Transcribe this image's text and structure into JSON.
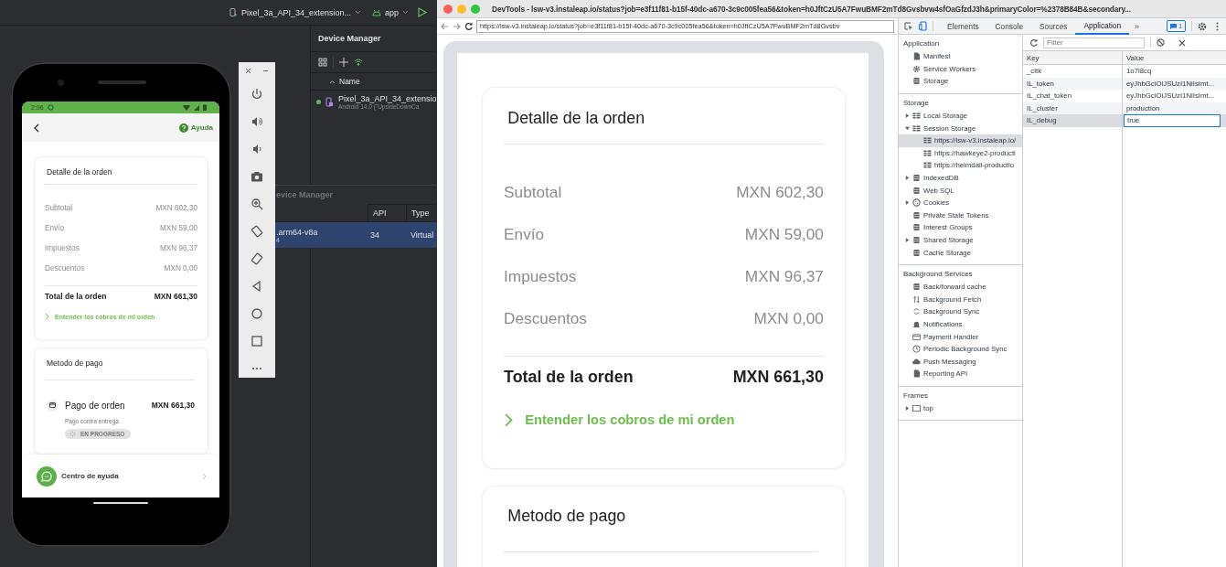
{
  "android_studio": {
    "toolbar": {
      "device": "Pixel_3a_API_34_extension...",
      "run_config": "app"
    },
    "device_manager": {
      "title": "Device Manager",
      "column": "Name",
      "devices": [
        {
          "name": "Pixel_3a_API_34_extensio",
          "details": "Android 14.0 (\"UpsideDownCa",
          "running": true
        }
      ]
    },
    "device_manager_window": {
      "title": "evice Manager",
      "columns": [
        "API",
        "Type"
      ],
      "rows": [
        {
          "name": ".arm64-v8a",
          "details": "4",
          "api": "34",
          "type": "Virtual",
          "selected": true
        }
      ]
    }
  },
  "phone": {
    "status_bar": {
      "time": "2:06"
    },
    "help_link": "Ayuda",
    "order_card": {
      "title": "Detalle de la orden",
      "rows": [
        {
          "label": "Subtotal",
          "amount": "MXN 602,30"
        },
        {
          "label": "Envío",
          "amount": "MXN 59,00"
        },
        {
          "label": "Impuestos",
          "amount": "MXN 96,37"
        },
        {
          "label": "Descuentos",
          "amount": "MXN 0,00"
        }
      ],
      "total": {
        "label": "Total de la orden",
        "amount": "MXN 661,30"
      },
      "link": "Entender los cobros de mi orden"
    },
    "payment_card": {
      "title": "Metodo de pago",
      "method": {
        "name": "Pago de orden",
        "amount": "MXN 661,30",
        "description": "Pago contra entrega",
        "status": "EN PROGRESO"
      }
    },
    "help_center": "Centro de ayuda"
  },
  "devtools": {
    "title": "DevTools - lsw-v3.instaleap.io/status?job=e3f11f81-b15f-40dc-a670-3c9c005fea56&token=h0JftCzU5A7FwuBMF2mTd8Gvsbvw4sfOaGfzdJ3h&primaryColor=%2378B84B&secondary...",
    "url": "https://lsw-v3.instaleap.io/status?job=e3f11f81-b15f-40dc-a670-3c9c005fea56&token=h0JftCzU5A7FwuBMF2mTd8Gvsbv",
    "page": {
      "order_card": {
        "title": "Detalle de la orden",
        "rows": [
          {
            "label": "Subtotal",
            "amount": "MXN 602,30"
          },
          {
            "label": "Envío",
            "amount": "MXN 59,00"
          },
          {
            "label": "Impuestos",
            "amount": "MXN 96,37"
          },
          {
            "label": "Descuentos",
            "amount": "MXN 0,00"
          }
        ],
        "total": {
          "label": "Total de la orden",
          "amount": "MXN 661,30"
        },
        "link": "Entender los cobros de mi orden"
      },
      "payment_card": {
        "title": "Metodo de pago"
      }
    },
    "tabs": [
      {
        "label": "Elements",
        "selected": false
      },
      {
        "label": "Console",
        "selected": false
      },
      {
        "label": "Sources",
        "selected": false
      },
      {
        "label": "Application",
        "selected": true
      }
    ],
    "more_tabs": "»",
    "issues_count": "1",
    "sidebar": [
      {
        "title": "Application",
        "items": [
          {
            "label": "Manifest",
            "kind": "file",
            "selected": false
          },
          {
            "label": "Service Workers",
            "kind": "gear",
            "selected": false
          },
          {
            "label": "Storage",
            "kind": "db",
            "selected": false
          }
        ]
      },
      {
        "title": "Storage",
        "items": [
          {
            "label": "Local Storage",
            "kind": "table",
            "expanded": false,
            "selected": false
          },
          {
            "label": "Session Storage",
            "kind": "table",
            "expanded": true,
            "selected": false,
            "children": [
              {
                "label": "https://lsw-v3.instaleap.io/",
                "kind": "table",
                "selected": true
              },
              {
                "label": "https://hawkeye2-producti",
                "kind": "table",
                "selected": false
              },
              {
                "label": "https://heimdall-productio",
                "kind": "table",
                "selected": false
              }
            ]
          },
          {
            "label": "IndexedDB",
            "kind": "db",
            "expanded": false,
            "selected": false
          },
          {
            "label": "Web SQL",
            "kind": "db",
            "selected": false
          },
          {
            "label": "Cookies",
            "kind": "cookie",
            "expanded": false,
            "selected": false
          },
          {
            "label": "Private State Tokens",
            "kind": "db",
            "selected": false
          },
          {
            "label": "Interest Groups",
            "kind": "db",
            "selected": false
          },
          {
            "label": "Shared Storage",
            "kind": "db",
            "expanded": false,
            "selected": false
          },
          {
            "label": "Cache Storage",
            "kind": "db",
            "selected": false
          }
        ]
      },
      {
        "title": "Background Services",
        "items": [
          {
            "label": "Back/forward cache",
            "kind": "db",
            "selected": false
          },
          {
            "label": "Background Fetch",
            "kind": "fetch",
            "selected": false
          },
          {
            "label": "Background Sync",
            "kind": "sync",
            "selected": false
          },
          {
            "label": "Notifications",
            "kind": "bell",
            "selected": false
          },
          {
            "label": "Payment Handler",
            "kind": "card",
            "selected": false
          },
          {
            "label": "Periodic Background Sync",
            "kind": "clock",
            "selected": false
          },
          {
            "label": "Push Messaging",
            "kind": "cloud",
            "selected": false
          },
          {
            "label": "Reporting API",
            "kind": "file",
            "selected": false
          }
        ]
      },
      {
        "title": "Frames",
        "items": [
          {
            "label": "top",
            "kind": "frame",
            "expanded": false,
            "selected": false
          }
        ]
      }
    ],
    "storage": {
      "filter_placeholder": "Filter",
      "columns": [
        "Key",
        "Value"
      ],
      "rows": [
        {
          "key": "_cltk",
          "value": "1o7l8cq",
          "selected": false
        },
        {
          "key": "IL_token",
          "value": "eyJhbGciOiJSUzI1NiIsImt...",
          "selected": false
        },
        {
          "key": "IL_chat_token",
          "value": "eyJhbGciOiJSUzI1NiIsImt...",
          "selected": false
        },
        {
          "key": "IL_cluster",
          "value": "production",
          "selected": false
        },
        {
          "key": "IL_debug",
          "value": "true",
          "selected": true
        }
      ]
    }
  }
}
